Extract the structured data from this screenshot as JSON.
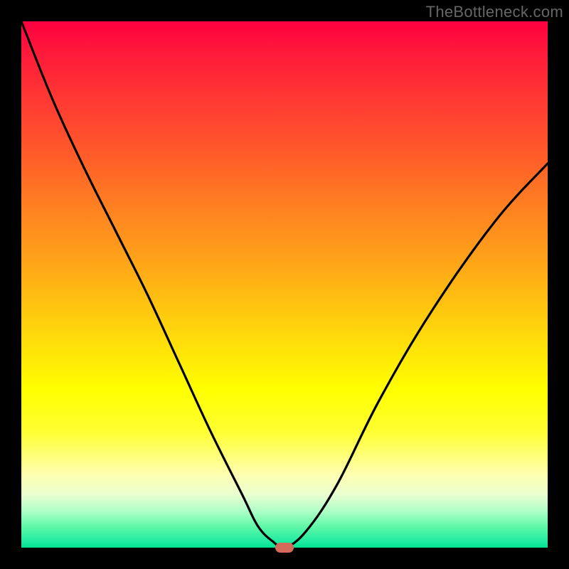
{
  "watermark": "TheBottleneck.com",
  "colors": {
    "frame": "#000000",
    "curve_stroke": "#000000",
    "marker": "#d46a5a",
    "gradient_top": "#ff0040",
    "gradient_mid": "#ffff00",
    "gradient_bottom": "#00e090",
    "watermark_text": "#666666"
  },
  "chart_data": {
    "type": "line",
    "title": "",
    "xlabel": "",
    "ylabel": "",
    "xlim": [
      0,
      100
    ],
    "ylim": [
      0,
      100
    ],
    "grid": false,
    "series": [
      {
        "name": "bottleneck-curve",
        "x": [
          0,
          6,
          12,
          18,
          24,
          30,
          36,
          42,
          45,
          48,
          50,
          54,
          60,
          68,
          78,
          90,
          100
        ],
        "y": [
          100,
          85,
          72,
          60,
          48,
          35,
          22,
          10,
          4,
          1,
          0,
          3,
          12,
          28,
          45,
          62,
          73
        ]
      }
    ],
    "marker": {
      "x": 50,
      "y": 0
    },
    "legend": false
  }
}
